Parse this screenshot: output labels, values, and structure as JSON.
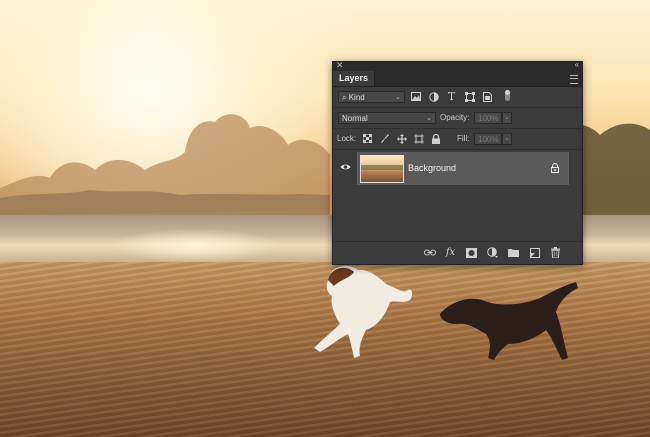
{
  "photo": {
    "description_colors": {
      "sky": "#fbe3b0",
      "sand": "#a87244",
      "water": "#cbb59b"
    }
  },
  "layers_panel": {
    "tab_label": "Layers",
    "filter": {
      "kind_label": "Kind",
      "icons": [
        "pixel-filter-icon",
        "adjustment-filter-icon",
        "type-filter-icon",
        "shape-filter-icon",
        "smart-object-filter-icon"
      ]
    },
    "blend_mode": "Normal",
    "opacity_label": "Opacity:",
    "opacity_value": "100%",
    "lock_label": "Lock:",
    "fill_label": "Fill:",
    "fill_value": "100%",
    "layers": [
      {
        "name": "Background",
        "visible": true,
        "locked": true
      }
    ],
    "bottom_icons": [
      "link-layers-icon",
      "fx-icon",
      "add-mask-icon",
      "adjustment-layer-icon",
      "new-group-icon",
      "new-layer-icon",
      "delete-layer-icon"
    ],
    "colors": {
      "panel_bg": "#3b3b3b",
      "selected_row": "#5a5a5a"
    }
  }
}
